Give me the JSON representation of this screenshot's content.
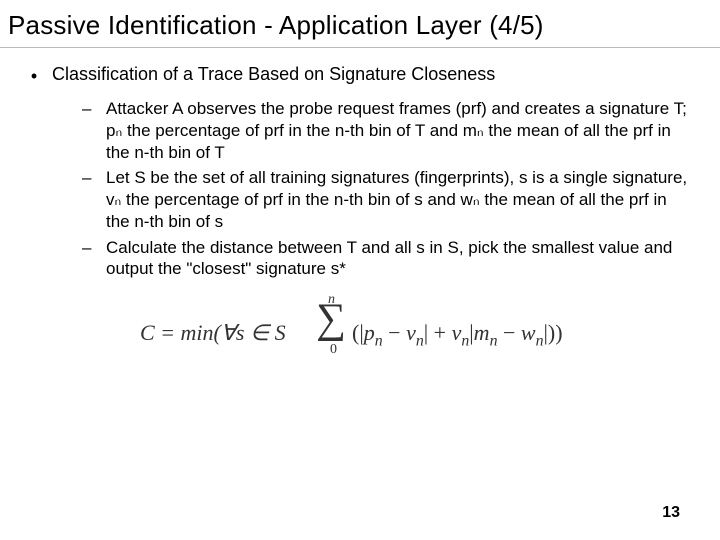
{
  "title": "Passive Identification - Application Layer (4/5)",
  "bullet": {
    "marker": "•",
    "text": "Classification of a Trace Based on Signature Closeness"
  },
  "sub": {
    "dash": "–",
    "items": [
      "Attacker A observes the probe request frames (prf) and creates a signature T; pₙ the percentage of prf in the n-th bin of T and mₙ the mean of all the prf in the n-th bin of T",
      "Let S be the set of all training signatures (fingerprints), s is a single signature, vₙ the percentage of prf in the n-th bin of s and wₙ the mean of all the prf in the n-th bin of s",
      "Calculate the distance between T and all s in S, pick the smallest value and output the \"closest\" signature s*"
    ]
  },
  "formula": {
    "lhs": "C = min(∀s ∈ S",
    "sum_top": "n",
    "sum_bottom": "0",
    "body_plain": "(|pₙ − vₙ| + vₙ|mₙ − wₙ|))"
  },
  "page_number": "13"
}
